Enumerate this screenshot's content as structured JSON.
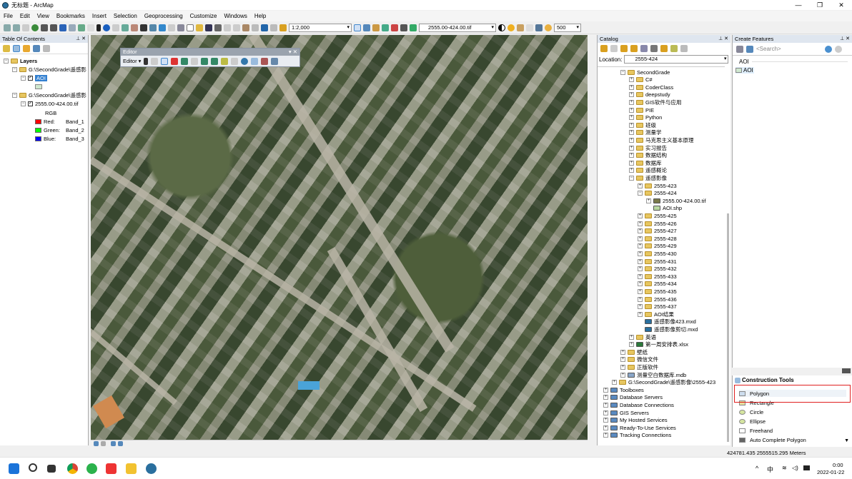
{
  "window": {
    "title": "无标题 - ArcMap",
    "min": "—",
    "max": "❐",
    "close": "✕"
  },
  "menu": [
    "File",
    "Edit",
    "View",
    "Bookmarks",
    "Insert",
    "Selection",
    "Geoprocessing",
    "Customize",
    "Windows",
    "Help"
  ],
  "toolbar": {
    "scale": "1:2,000",
    "raster_layer": "2555.00-424.00.tif",
    "value": "500"
  },
  "toc": {
    "title": "Table Of Contents",
    "root": "Layers",
    "group1": "G:\\SecondGrade\\遥感影",
    "layer_aoi": "AOI",
    "group2": "G:\\SecondGrade\\遥感影",
    "layer_tif": "2555.00-424.00.tif",
    "rgb": "RGB",
    "bands": [
      {
        "label": "Red:",
        "band": "Band_1",
        "color": "#ff0000"
      },
      {
        "label": "Green:",
        "band": "Band_2",
        "color": "#00ff00"
      },
      {
        "label": "Blue:",
        "band": "Band_3",
        "color": "#0000ff"
      }
    ]
  },
  "editor": {
    "title": "Editor",
    "menu": "Editor ▾"
  },
  "catalog": {
    "title": "Catalog",
    "location_label": "Location:",
    "location": "2555-424",
    "items": [
      {
        "t": "SecondGrade",
        "lvl": 2,
        "e": "⊟"
      },
      {
        "t": "C#",
        "lvl": 3,
        "e": "⊞"
      },
      {
        "t": "CoderClass",
        "lvl": 3,
        "e": "⊞"
      },
      {
        "t": "deepstudy",
        "lvl": 3,
        "e": "⊞"
      },
      {
        "t": "GIS软件与应用",
        "lvl": 3,
        "e": "⊞"
      },
      {
        "t": "PIE",
        "lvl": 3,
        "e": "⊞"
      },
      {
        "t": "Python",
        "lvl": 3,
        "e": "⊞"
      },
      {
        "t": "班级",
        "lvl": 3,
        "e": "⊞"
      },
      {
        "t": "测量学",
        "lvl": 3,
        "e": "⊞"
      },
      {
        "t": "马克思主义基本原理",
        "lvl": 3,
        "e": "⊞"
      },
      {
        "t": "实习报告",
        "lvl": 3,
        "e": "⊞"
      },
      {
        "t": "数据结构",
        "lvl": 3,
        "e": "⊞"
      },
      {
        "t": "数据库",
        "lvl": 3,
        "e": "⊞"
      },
      {
        "t": "遥感概论",
        "lvl": 3,
        "e": "⊞"
      },
      {
        "t": "遥感影像",
        "lvl": 3,
        "e": "⊟"
      },
      {
        "t": "2555-423",
        "lvl": 4,
        "e": "⊞"
      },
      {
        "t": "2555-424",
        "lvl": 4,
        "e": "⊟"
      },
      {
        "t": "2555.00-424.00.tif",
        "lvl": 5,
        "e": "⊞",
        "k": "raster"
      },
      {
        "t": "AOI.shp",
        "lvl": 5,
        "e": "",
        "k": "shp"
      },
      {
        "t": "2555-425",
        "lvl": 4,
        "e": "⊞"
      },
      {
        "t": "2555-426",
        "lvl": 4,
        "e": "⊞"
      },
      {
        "t": "2555-427",
        "lvl": 4,
        "e": "⊞"
      },
      {
        "t": "2555-428",
        "lvl": 4,
        "e": "⊞"
      },
      {
        "t": "2555-429",
        "lvl": 4,
        "e": "⊞"
      },
      {
        "t": "2555-430",
        "lvl": 4,
        "e": "⊞"
      },
      {
        "t": "2555-431",
        "lvl": 4,
        "e": "⊞"
      },
      {
        "t": "2555-432",
        "lvl": 4,
        "e": "⊞"
      },
      {
        "t": "2555-433",
        "lvl": 4,
        "e": "⊞"
      },
      {
        "t": "2555-434",
        "lvl": 4,
        "e": "⊞"
      },
      {
        "t": "2555-435",
        "lvl": 4,
        "e": "⊞"
      },
      {
        "t": "2555-436",
        "lvl": 4,
        "e": "⊞"
      },
      {
        "t": "2555-437",
        "lvl": 4,
        "e": "⊞"
      },
      {
        "t": "AOI结果",
        "lvl": 4,
        "e": "⊞"
      },
      {
        "t": "遥感影像423.mxd",
        "lvl": 4,
        "e": "",
        "k": "mxd"
      },
      {
        "t": "遥感影像剪切.mxd",
        "lvl": 4,
        "e": "",
        "k": "mxd"
      },
      {
        "t": "英语",
        "lvl": 3,
        "e": "⊞"
      },
      {
        "t": "第一周安排表.xlsx",
        "lvl": 3,
        "e": "⊞",
        "k": "xlsx"
      },
      {
        "t": "壁纸",
        "lvl": 2,
        "e": "⊞"
      },
      {
        "t": "微信文件",
        "lvl": 2,
        "e": "⊞"
      },
      {
        "t": "正版软件",
        "lvl": 2,
        "e": "⊞"
      },
      {
        "t": "测量空白数据库.mdb",
        "lvl": 2,
        "e": "⊞",
        "k": "mdb"
      },
      {
        "t": "G:\\SecondGrade\\遥感影像\\2555-423",
        "lvl": 1,
        "e": "⊞"
      },
      {
        "t": "Toolboxes",
        "lvl": 0,
        "e": "⊞",
        "k": "sys"
      },
      {
        "t": "Database Servers",
        "lvl": 0,
        "e": "⊞",
        "k": "sys"
      },
      {
        "t": "Database Connections",
        "lvl": 0,
        "e": "⊞",
        "k": "sys"
      },
      {
        "t": "GIS Servers",
        "lvl": 0,
        "e": "⊞",
        "k": "sys"
      },
      {
        "t": "My Hosted Services",
        "lvl": 0,
        "e": "⊞",
        "k": "sys"
      },
      {
        "t": "Ready-To-Use Services",
        "lvl": 0,
        "e": "⊞",
        "k": "sys"
      },
      {
        "t": "Tracking Connections",
        "lvl": 0,
        "e": "⊞",
        "k": "sys"
      }
    ]
  },
  "create_features": {
    "title": "Create Features",
    "search_placeholder": "<Search>",
    "group": "AOI",
    "template": "AOI"
  },
  "construction_tools": {
    "title": "Construction Tools",
    "tools": [
      "Polygon",
      "Rectangle",
      "Circle",
      "Ellipse",
      "Freehand",
      "Auto Complete Polygon"
    ],
    "highlight_color": "#e02020"
  },
  "status": {
    "coords": "424781.435  2555515.295 Meters"
  },
  "tray": {
    "caret": "^",
    "ime": "中",
    "time": "0:00",
    "date": "2022-01-22"
  }
}
